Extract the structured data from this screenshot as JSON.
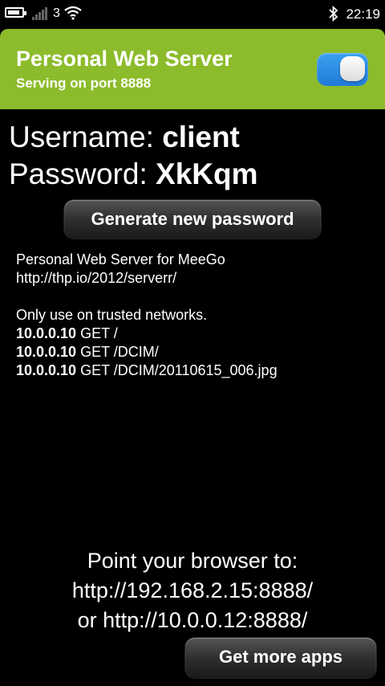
{
  "status": {
    "network": "3",
    "time": "22:19",
    "battery_level": 0.7
  },
  "header": {
    "title": "Personal Web Server",
    "subtitle": "Serving on port 8888",
    "toggle_on": true
  },
  "credentials": {
    "username_label": "Username:",
    "username": "client",
    "password_label": "Password:",
    "password": "XkKqm"
  },
  "generate_button": "Generate new password",
  "info": {
    "line1": "Personal Web Server for MeeGo",
    "line2": "http://thp.io/2012/serverr/",
    "line3": "Only use on trusted networks."
  },
  "log": [
    {
      "ip": "10.0.0.10",
      "request": "GET /"
    },
    {
      "ip": "10.0.0.10",
      "request": "GET /DCIM/"
    },
    {
      "ip": "10.0.0.10",
      "request": "GET /DCIM/20110615_006.jpg"
    }
  ],
  "point": {
    "line1": "Point your browser to:",
    "line2": "http://192.168.2.15:8888/",
    "line3": "or http://10.0.0.12:8888/"
  },
  "more_apps_button": "Get more apps",
  "colors": {
    "header": "#8cbc2c",
    "toggle": "#1f7ad6",
    "background": "#000000"
  }
}
